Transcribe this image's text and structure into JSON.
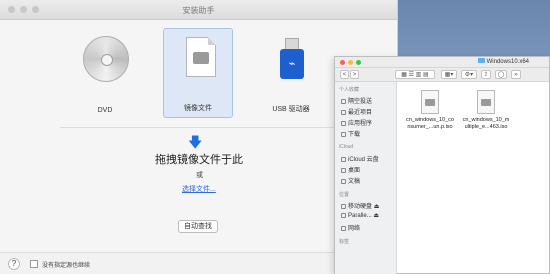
{
  "main": {
    "title": "安装助手",
    "sources": [
      {
        "label": "DVD",
        "icon": "dvd-disc-icon"
      },
      {
        "label": "镜像文件",
        "icon": "disk-image-file-icon"
      },
      {
        "label": "USB 驱动器",
        "icon": "usb-drive-icon"
      }
    ],
    "drop_title": "拖拽镜像文件于此",
    "or_text": "或",
    "choose_link": "选择文件...",
    "auto_find_button": "自动查找",
    "help_label": "?",
    "checkbox_label": "没有指定源也继续",
    "accent_color": "#1e6fe0"
  },
  "finder": {
    "title": "Windows10.x64",
    "toolbar": {
      "back": "<",
      "forward": ">"
    },
    "sidebar": {
      "favorites_heading": "个人收藏",
      "favorites": [
        "隔空投送",
        "最近项目",
        "应用程序",
        "下载"
      ],
      "icloud_heading": "iCloud",
      "icloud": [
        "iCloud 云盘",
        "桌面",
        "文稿"
      ],
      "locations_heading": "位置",
      "locations": [
        "移动硬盘",
        "Paralle...",
        "网络"
      ],
      "tags_heading": "标签"
    },
    "files": [
      {
        "name_line1": "cn_windows_10_co",
        "name_line2": "nsumer_...un.p.iso"
      },
      {
        "name_line1": "cn_windows_10_m",
        "name_line2": "ultiple_e...463.iso"
      }
    ]
  }
}
